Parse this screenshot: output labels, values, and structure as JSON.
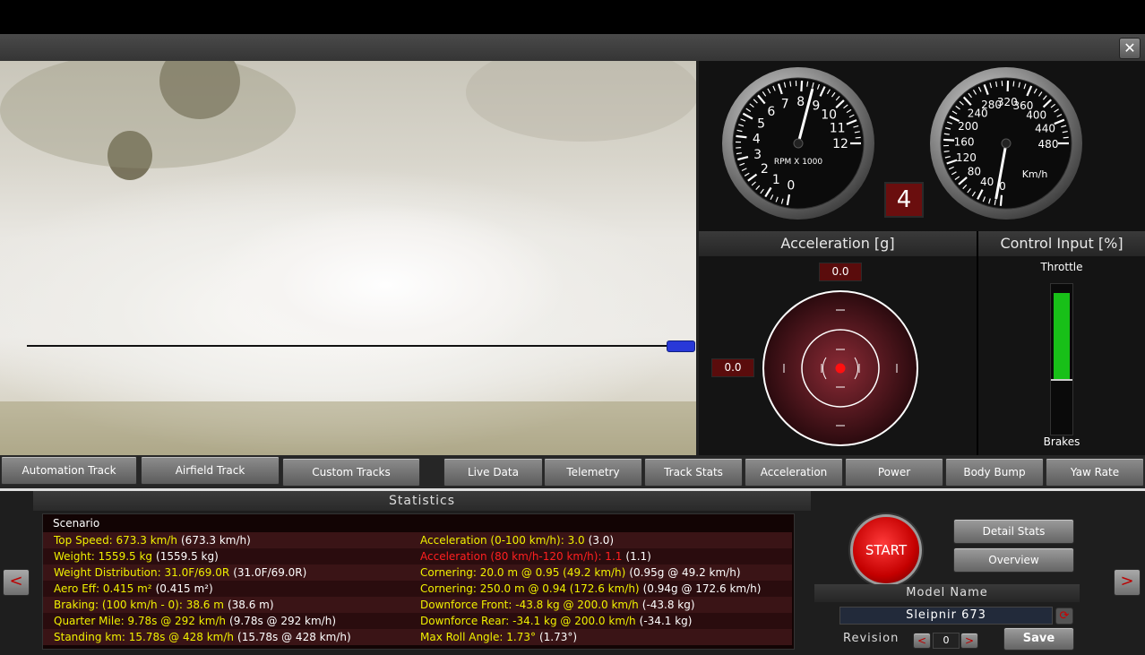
{
  "window": {
    "close_label": "✕"
  },
  "gauges": {
    "rpm": {
      "label": "RPM X 1000",
      "ticks": [
        "0",
        "1",
        "2",
        "3",
        "4",
        "5",
        "6",
        "7",
        "8",
        "9",
        "10",
        "11",
        "12"
      ]
    },
    "speed": {
      "label": "Km/h",
      "ticks": [
        "0",
        "40",
        "80",
        "120",
        "160",
        "200",
        "240",
        "280",
        "320",
        "360",
        "400",
        "440",
        "480"
      ]
    },
    "gear": "4"
  },
  "acceleration": {
    "title": "Acceleration [g]",
    "long": "0.0",
    "lat": "0.0"
  },
  "control_input": {
    "title": "Control Input [%]",
    "throttle_label": "Throttle",
    "brakes_label": "Brakes",
    "throttle_level": 0.7
  },
  "tabs_left": [
    "Automation Track",
    "Airfield Track",
    "Custom Tracks"
  ],
  "tabs_right": [
    "Live Data",
    "Telemetry",
    "Track Stats",
    "Acceleration",
    "Power",
    "Body Bump",
    "Yaw Rate"
  ],
  "statistics": {
    "title": "Statistics",
    "scenario": "Scenario",
    "left": [
      {
        "main": "Top Speed: 673.3 km/h",
        "extra": "(673.3 km/h)",
        "color": "#f0f000"
      },
      {
        "main": "Weight: 1559.5 kg",
        "extra": "(1559.5 kg)",
        "color": "#f0f000"
      },
      {
        "main": "Weight Distribution: 31.0F/69.0R",
        "extra": "(31.0F/69.0R)",
        "color": "#f0f000"
      },
      {
        "main": "Aero Eff: 0.415 m²",
        "extra": "(0.415 m²)",
        "color": "#f0f000"
      },
      {
        "main": "Braking: (100 km/h - 0): 38.6 m",
        "extra": "(38.6 m)",
        "color": "#f0f000"
      },
      {
        "main": "Quarter Mile: 9.78s @ 292 km/h",
        "extra": "(9.78s @ 292 km/h)",
        "color": "#f0f000"
      },
      {
        "main": "Standing km: 15.78s @ 428 km/h",
        "extra": "(15.78s @ 428 km/h)",
        "color": "#f0f000"
      }
    ],
    "right": [
      {
        "main": "Acceleration (0-100 km/h): 3.0",
        "extra": "(3.0)",
        "color": "#f0f000"
      },
      {
        "main": "Acceleration (80 km/h-120 km/h): 1.1",
        "extra": "(1.1)",
        "color": "#ff2020"
      },
      {
        "main": "Cornering: 20.0 m @ 0.95 (49.2 km/h)",
        "extra": "(0.95g @ 49.2 km/h)",
        "color": "#f0f000"
      },
      {
        "main": "Cornering: 250.0 m @ 0.94 (172.6 km/h)",
        "extra": "(0.94g @ 172.6 km/h)",
        "color": "#f0f000"
      },
      {
        "main": "Downforce Front: -43.8 kg @ 200.0 km/h",
        "extra": "(-43.8 kg)",
        "color": "#f0f000"
      },
      {
        "main": "Downforce Rear: -34.1 kg @ 200.0 km/h",
        "extra": "(-34.1 kg)",
        "color": "#f0f000"
      },
      {
        "main": "Max Roll Angle: 1.73°",
        "extra": "(1.73°)",
        "color": "#f0f000"
      }
    ]
  },
  "controls": {
    "start": "START",
    "detail_stats": "Detail Stats",
    "overview": "Overview",
    "model_name_label": "Model Name",
    "model_name": "Sleipnir 673",
    "revision_label": "Revision",
    "revision": "0",
    "save": "Save",
    "prev": "<",
    "next": ">"
  }
}
